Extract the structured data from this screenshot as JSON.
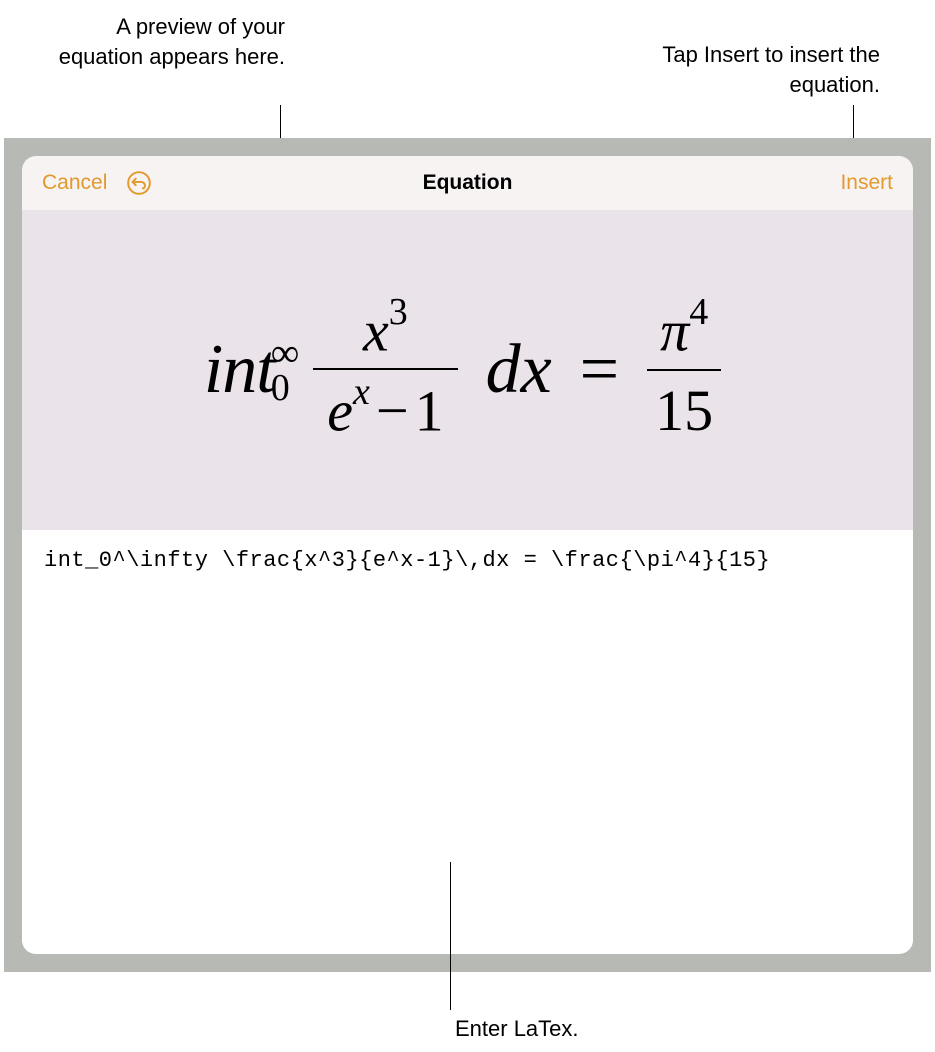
{
  "callouts": {
    "preview": "A preview of your equation appears here.",
    "insert": "Tap Insert to insert the equation.",
    "input": "Enter LaTex."
  },
  "dialog": {
    "cancel_label": "Cancel",
    "title": "Equation",
    "insert_label": "Insert"
  },
  "equation": {
    "latex_source": "int_0^\\infty \\frac{x^3}{e^x-1}\\,dx = \\frac{\\pi^4}{15}",
    "rendered": {
      "prefix": "int",
      "upper": "∞",
      "lower": "0",
      "frac1_num_base": "x",
      "frac1_num_exp": "3",
      "frac1_den_base": "e",
      "frac1_den_exp": "x",
      "frac1_den_minus": "−",
      "frac1_den_one": "1",
      "dx": "dx",
      "equals": "=",
      "frac2_num_base": "π",
      "frac2_num_exp": "4",
      "frac2_den": "15"
    }
  }
}
